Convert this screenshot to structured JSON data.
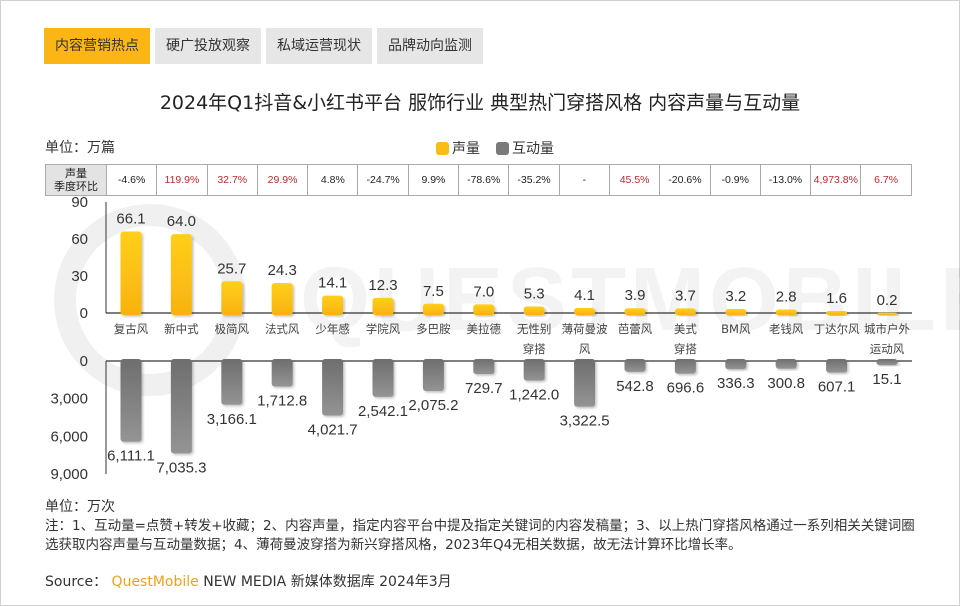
{
  "tabs": [
    {
      "label": "内容营销热点",
      "active": true
    },
    {
      "label": "硬广投放观察",
      "active": false
    },
    {
      "label": "私域运营现状",
      "active": false
    },
    {
      "label": "品牌动向监测",
      "active": false
    }
  ],
  "title": "2024年Q1抖音&小红书平台 服饰行业 典型热门穿搭风格 内容声量与互动量",
  "unit_top": "单位：万篇",
  "unit_bottom": "单位：万次",
  "legend": [
    {
      "label": "声量",
      "color": "#fbbd14"
    },
    {
      "label": "互动量",
      "color": "#7a7a7a"
    }
  ],
  "growth_table": {
    "header_line1": "声量",
    "header_line2": "季度环比",
    "values": [
      "-4.6%",
      "119.9%",
      "32.7%",
      "29.9%",
      "4.8%",
      "-24.7%",
      "9.9%",
      "-78.6%",
      "-35.2%",
      "-",
      "45.5%",
      "-20.6%",
      "-0.9%",
      "-13.0%",
      "4,973.8%",
      "6.7%"
    ],
    "highlight": [
      false,
      true,
      true,
      true,
      false,
      false,
      false,
      false,
      false,
      false,
      true,
      false,
      false,
      false,
      true,
      true
    ],
    "highlight_color": "#c0282d"
  },
  "chart_data": [
    {
      "type": "bar",
      "title": "内容声量",
      "ylabel": "单位：万篇",
      "categories": [
        "复古风",
        "新中式",
        "极简风",
        "法式风",
        "少年感",
        "学院风",
        "多巴胺",
        "美拉德",
        "无性别穿搭",
        "薄荷曼波风",
        "芭蕾风",
        "美式穿搭",
        "BM风",
        "老钱风",
        "丁达尔风",
        "城市户外运动风"
      ],
      "category_lines": [
        [
          "复古风"
        ],
        [
          "新中式"
        ],
        [
          "极简风"
        ],
        [
          "法式风"
        ],
        [
          "少年感"
        ],
        [
          "学院风"
        ],
        [
          "多巴胺"
        ],
        [
          "美拉德"
        ],
        [
          "无性别",
          "穿搭"
        ],
        [
          "薄荷曼波",
          "风"
        ],
        [
          "芭蕾风"
        ],
        [
          "美式",
          "穿搭"
        ],
        [
          "BM风"
        ],
        [
          "老钱风"
        ],
        [
          "丁达尔风"
        ],
        [
          "城市户外",
          "运动风"
        ]
      ],
      "series": [
        {
          "name": "声量",
          "values": [
            66.1,
            64.0,
            25.7,
            24.3,
            14.1,
            12.3,
            7.5,
            7.0,
            5.3,
            4.1,
            3.9,
            3.7,
            3.2,
            2.8,
            1.6,
            0.2
          ],
          "color": "#fbbd14"
        }
      ],
      "labels": [
        "66.1",
        "64.0",
        "25.7",
        "24.3",
        "14.1",
        "12.3",
        "7.5",
        "7.0",
        "5.3",
        "4.1",
        "3.9",
        "3.7",
        "3.2",
        "2.8",
        "1.6",
        "0.2"
      ],
      "ylim": [
        0,
        90
      ],
      "yticks": [
        "0",
        "30",
        "60",
        "90"
      ],
      "ytick_values": [
        0,
        30,
        60,
        90
      ],
      "grid": false
    },
    {
      "type": "bar",
      "title": "互动量",
      "ylabel": "单位：万次",
      "orientation": "downward",
      "categories": [
        "复古风",
        "新中式",
        "极简风",
        "法式风",
        "少年感",
        "学院风",
        "多巴胺",
        "美拉德",
        "无性别穿搭",
        "薄荷曼波风",
        "芭蕾风",
        "美式穿搭",
        "BM风",
        "老钱风",
        "丁达尔风",
        "城市户外运动风"
      ],
      "series": [
        {
          "name": "互动量",
          "values": [
            6111.1,
            7035.3,
            3166.1,
            1712.8,
            4021.7,
            2542.1,
            2075.2,
            729.7,
            1242.0,
            3322.5,
            542.8,
            696.6,
            336.3,
            300.8,
            607.1,
            15.1
          ],
          "color": "#7a7a7a"
        }
      ],
      "labels": [
        "6,111.1",
        "7,035.3",
        "3,166.1",
        "1,712.8",
        "4,021.7",
        "2,542.1",
        "2,075.2",
        "729.7",
        "1,242.0",
        "3,322.5",
        "542.8",
        "696.6",
        "336.3",
        "300.8",
        "607.1",
        "15.1"
      ],
      "ylim": [
        0,
        9000
      ],
      "yticks": [
        "0",
        "3,000",
        "6,000",
        "9,000"
      ],
      "ytick_values": [
        0,
        3000,
        6000,
        9000
      ],
      "grid": false
    }
  ],
  "note": "注：1、互动量=点赞+转发+收藏；2、内容声量，指定内容平台中提及指定关键词的内容发稿量；3、以上热门穿搭风格通过一系列相关关键词圈选获取内容声量与互动量数据；4、薄荷曼波穿搭为新兴穿搭风格，2023年Q4无相关数据，故无法计算环比增长率。",
  "source": {
    "prefix": "Source：",
    "brand": "QuestMobile",
    "suffix": "NEW MEDIA 新媒体数据库 2024年3月"
  },
  "watermark": "QUESTMOBILE"
}
